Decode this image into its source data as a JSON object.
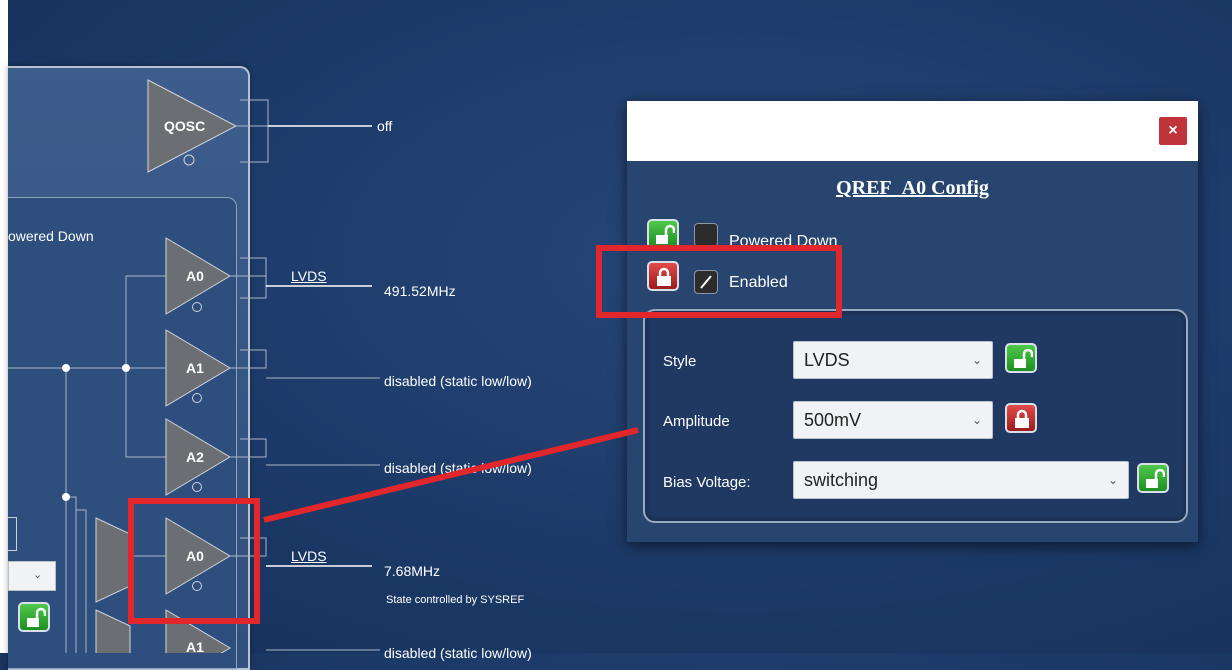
{
  "diagram": {
    "powered_down_partial": "owered Down",
    "qosc_label": "QOSC",
    "qosc_output": "off",
    "buffers": [
      {
        "name": "A0",
        "style": "LVDS",
        "output": "491.52MHz"
      },
      {
        "name": "A1",
        "style": "",
        "output": "disabled (static low/low)"
      },
      {
        "name": "A2",
        "style": "",
        "output": "disabled (static low/low)"
      },
      {
        "name": "A0",
        "style": "LVDS",
        "output": "7.68MHz",
        "note": "State controlled by SYSREF"
      },
      {
        "name": "A1",
        "style": "",
        "output": "disabled (static low/low)"
      }
    ]
  },
  "dialog": {
    "close_label": "×",
    "title": "QREF_A0 Config",
    "powered_down_label": "Powered Down",
    "enabled_label": "Enabled",
    "style_label": "Style",
    "style_value": "LVDS",
    "amplitude_label": "Amplitude",
    "amplitude_value": "500mV",
    "bias_label": "Bias Voltage:",
    "bias_value": "switching"
  },
  "colors": {
    "background": "#1c3a68",
    "lock_unlocked": "#2fae2f",
    "lock_locked": "#c0333a",
    "annotation": "#e1262c"
  }
}
